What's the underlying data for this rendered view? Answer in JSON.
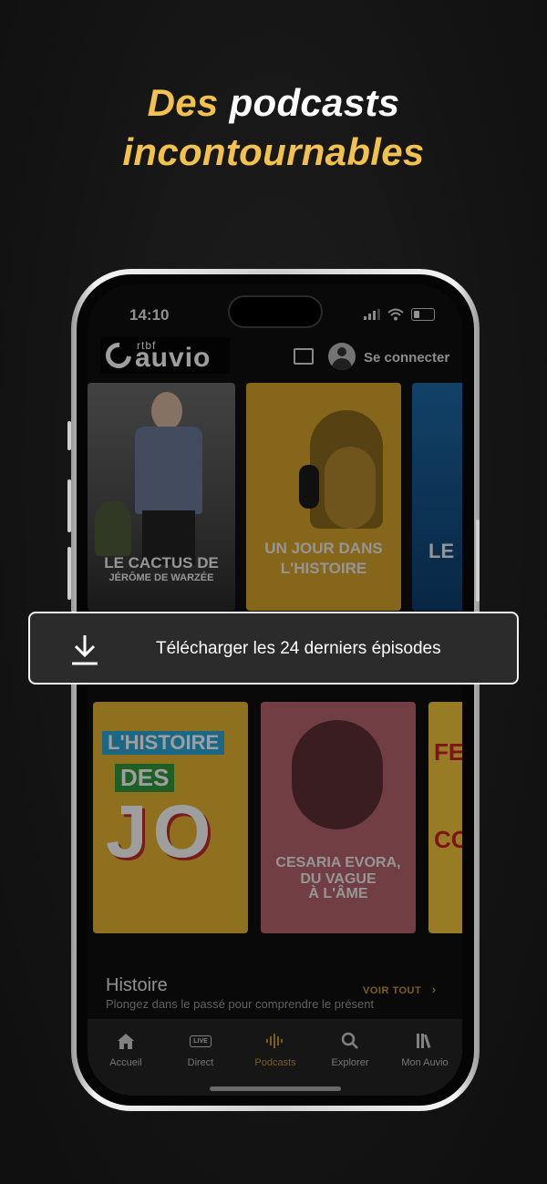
{
  "headline": {
    "line1_gold": "Des",
    "line1_white": "podcasts",
    "line2_gold": "incontournables"
  },
  "status_bar": {
    "time": "14:10"
  },
  "header": {
    "logo_small": "rtbf",
    "logo_big": "auvio",
    "login_label": "Se connecter"
  },
  "carousel_top": [
    {
      "title_line1": "LE CACTUS DE",
      "title_line2": "JÉRÔME DE WARZÉE"
    },
    {
      "title_line1": "UN JOUR DANS",
      "title_line2": "L'HISTOIRE"
    },
    {
      "title_line1": "LE"
    }
  ],
  "carousel_bottom": [
    {
      "line1": "L'HISTOIRE",
      "line2": "DES",
      "line3": "JO"
    },
    {
      "line1": "CESARIA EVORA,",
      "line2": "DU VAGUE",
      "line3": "À L'ÂME"
    },
    {
      "line1": "FE",
      "line2": "CO"
    }
  ],
  "section": {
    "title": "Histoire",
    "see_all": "VOIR TOUT",
    "subtitle": "Plongez dans le passé pour comprendre le présent"
  },
  "tabs": [
    {
      "label": "Accueil",
      "icon": "home-icon"
    },
    {
      "label": "Direct",
      "icon": "live-icon"
    },
    {
      "label": "Podcasts",
      "icon": "podcast-wave-icon"
    },
    {
      "label": "Explorer",
      "icon": "search-icon"
    },
    {
      "label": "Mon Auvio",
      "icon": "library-icon"
    }
  ],
  "download": {
    "label": "Télécharger les 24 derniers épisodes",
    "icon": "download-icon"
  },
  "colors": {
    "accent_gold": "#f2c14e",
    "podcast_tab_active": "#c69a2a",
    "background": "#141414"
  }
}
